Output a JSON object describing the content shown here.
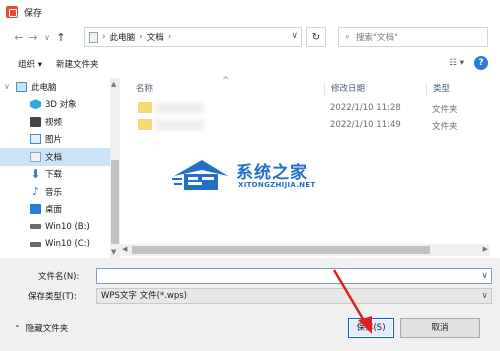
{
  "window": {
    "title": "保存"
  },
  "nav": {
    "back_icon": "arrow-left-icon",
    "forward_icon": "arrow-right-icon",
    "recent_icon": "chevron-down-icon",
    "up_icon": "arrow-up-icon",
    "breadcrumb": [
      "此电脑",
      "文档"
    ],
    "refresh_icon": "refresh-icon",
    "search_placeholder": "搜索\"文档\""
  },
  "toolbar": {
    "organize_label": "组织 ▾",
    "new_folder_label": "新建文件夹",
    "help_label": "?"
  },
  "sidebar": {
    "items": [
      {
        "label": "此电脑",
        "icon": "computer-icon"
      },
      {
        "label": "3D 对象",
        "icon": "cube-icon"
      },
      {
        "label": "视频",
        "icon": "video-icon"
      },
      {
        "label": "图片",
        "icon": "picture-icon"
      },
      {
        "label": "文档",
        "icon": "document-icon",
        "selected": true
      },
      {
        "label": "下载",
        "icon": "download-icon"
      },
      {
        "label": "音乐",
        "icon": "music-icon"
      },
      {
        "label": "桌面",
        "icon": "desktop-icon"
      },
      {
        "label": "Win10 (B:)",
        "icon": "drive-icon"
      },
      {
        "label": "Win10 (C:)",
        "icon": "drive-icon"
      }
    ]
  },
  "filelist": {
    "columns": {
      "name": "名称",
      "date": "修改日期",
      "type": "类型"
    },
    "rows": [
      {
        "name": "",
        "date": "2022/1/10 11:28",
        "type": "文件夹"
      },
      {
        "name": "",
        "date": "2022/1/10 11:49",
        "type": "文件夹"
      }
    ]
  },
  "watermark": {
    "title": "系统之家",
    "subtitle": "XITONGZHIJIA.NET"
  },
  "form": {
    "filename_label": "文件名(N):",
    "filename_value": "",
    "filetype_label": "保存类型(T):",
    "filetype_value": "WPS文字 文件(*.wps)",
    "hide_folders_label": "隐藏文件夹",
    "save_label": "保存(S)",
    "cancel_label": "取消"
  },
  "colors": {
    "accent": "#2b7bd8",
    "annotation_arrow": "#e02020",
    "watermark": "#2370c7"
  }
}
